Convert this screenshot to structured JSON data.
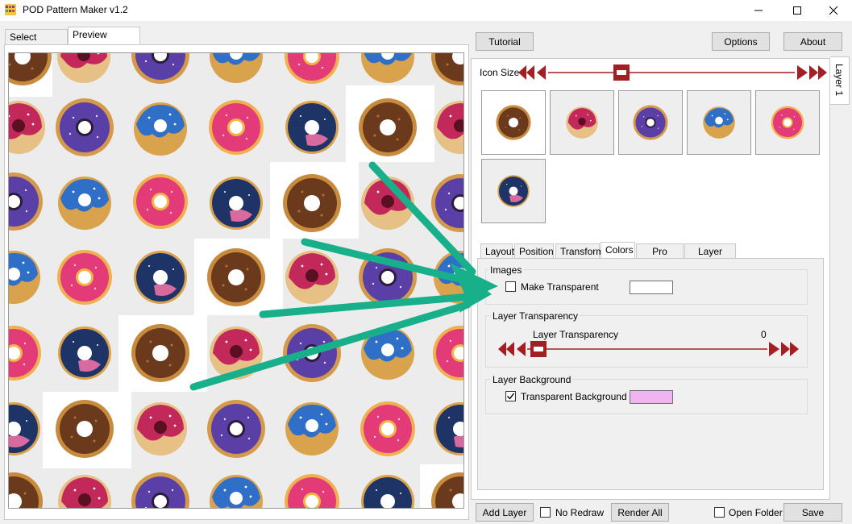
{
  "window": {
    "title": "POD Pattern Maker v1.2"
  },
  "left_tabs": {
    "select_images": "Select Images",
    "preview_pattern": "Preview Pattern"
  },
  "toolbar": {
    "tutorial": "Tutorial",
    "options": "Options",
    "about": "About"
  },
  "layer_tab": "Layer 1",
  "icon_size": {
    "label": "Icon Size"
  },
  "sub_tabs": [
    "Layout",
    "Position",
    "Transform",
    "Colors",
    "Pro Colors",
    "Layer Tools"
  ],
  "colors_panel": {
    "images_group": "Images",
    "make_transparent": "Make Transparent",
    "make_transparent_checked": false,
    "make_transparent_color": "#ffffff",
    "transparency_group": "Layer Transparency",
    "transparency_label": "Layer Transparency",
    "transparency_value": "0",
    "background_group": "Layer Background",
    "transparent_bg_label": "Transparent  Background",
    "transparent_bg_checked": true,
    "background_color": "#f0b4f0"
  },
  "bottom": {
    "add_layer": "Add Layer",
    "no_redraw": "No Redraw",
    "render_all": "Render All",
    "open_folder": "Open Folder",
    "save": "Save"
  },
  "colors": {
    "accent_red": "#a31f24",
    "arrow_teal": "#17b08a"
  }
}
